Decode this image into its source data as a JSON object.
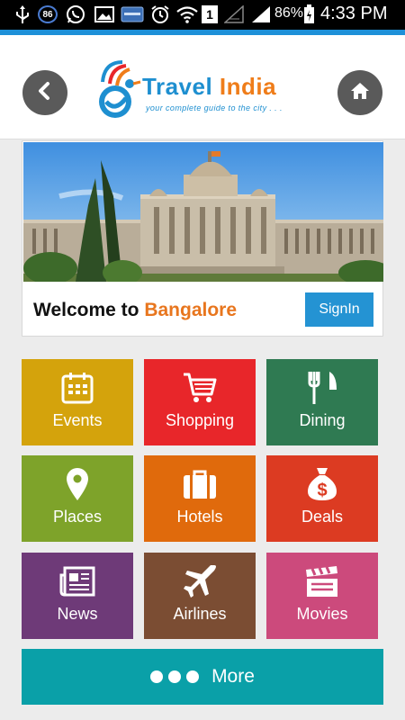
{
  "status_bar": {
    "notification_badge": "86",
    "sim_indicator": "1",
    "battery_percent": "86%",
    "time": "4:33 PM",
    "icons": [
      "usb-icon",
      "whatsapp-icon",
      "gallery-icon",
      "app-icon",
      "alarm-icon",
      "wifi-icon",
      "no-signal-icon",
      "signal-icon",
      "battery-icon"
    ]
  },
  "header": {
    "logo_title_part1": "Travel",
    "logo_title_part2": "India",
    "tagline": "your complete guide to the city . . .",
    "back_icon": "chevron-left-icon",
    "home_icon": "home-icon"
  },
  "banner": {
    "welcome_prefix": "Welcome to ",
    "city": "Bangalore",
    "signin_label": "SignIn"
  },
  "tiles": [
    {
      "label": "Events",
      "color": "#d4a30c",
      "icon": "calendar-icon"
    },
    {
      "label": "Shopping",
      "color": "#e8262a",
      "icon": "cart-icon"
    },
    {
      "label": "Dining",
      "color": "#2f7a52",
      "icon": "fork-knife-icon"
    },
    {
      "label": "Places",
      "color": "#7ea32a",
      "icon": "map-pin-icon"
    },
    {
      "label": "Hotels",
      "color": "#e06a0c",
      "icon": "suitcase-icon"
    },
    {
      "label": "Deals",
      "color": "#dc3b22",
      "icon": "money-bag-icon"
    },
    {
      "label": "News",
      "color": "#6e3a78",
      "icon": "newspaper-icon"
    },
    {
      "label": "Airlines",
      "color": "#7b4d33",
      "icon": "airplane-icon"
    },
    {
      "label": "Movies",
      "color": "#cc4a7c",
      "icon": "clapperboard-icon"
    }
  ],
  "more": {
    "label": "More",
    "icon": "dots-icon"
  },
  "colors": {
    "accent_blue": "#1e90d8",
    "header_bg": "#ffffff",
    "page_bg": "#ececec",
    "city_orange": "#e8761e",
    "signin_blue": "#2493d3",
    "more_teal": "#0aa0a8",
    "round_button_gray": "#5a5a5a"
  }
}
